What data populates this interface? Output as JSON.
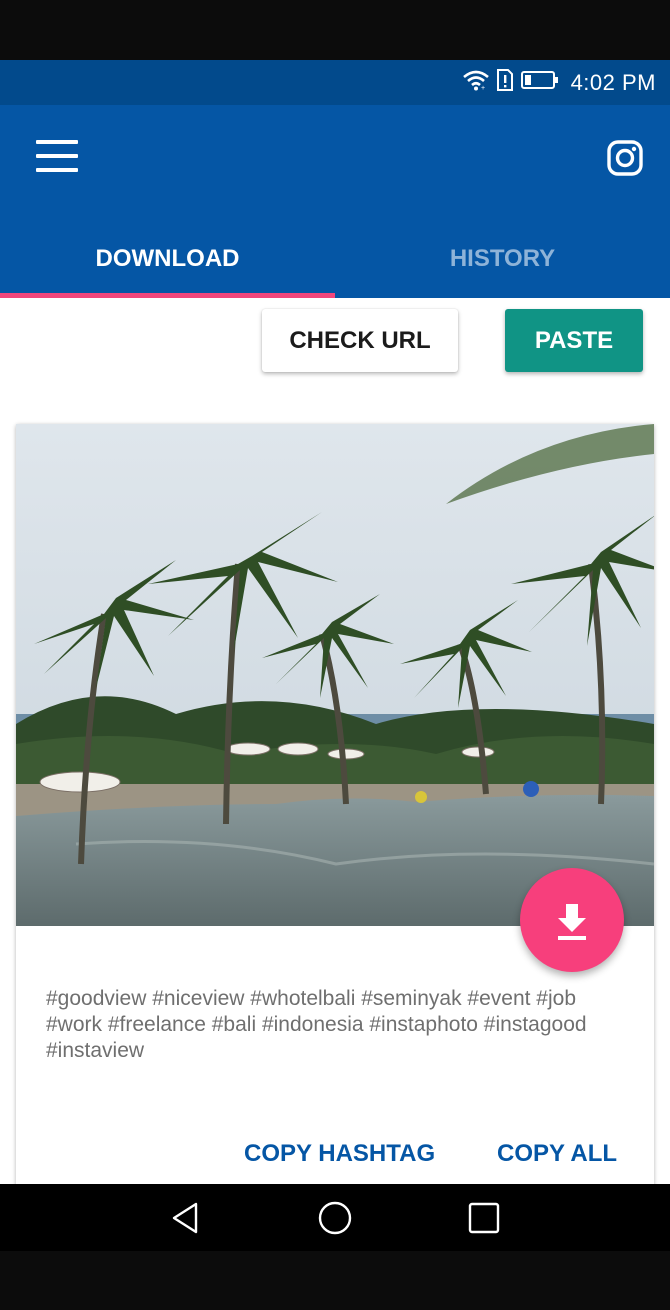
{
  "status_bar": {
    "time": "4:02 PM",
    "icons": [
      "wifi-icon",
      "sim-alert-icon",
      "battery-icon"
    ]
  },
  "app_bar": {
    "menu_icon": "hamburger-menu-icon",
    "action_icon": "instagram-icon"
  },
  "tabs": [
    {
      "label": "DOWNLOAD",
      "active": true
    },
    {
      "label": "HISTORY",
      "active": false
    }
  ],
  "actions": {
    "check_url_label": "CHECK URL",
    "paste_label": "PASTE"
  },
  "post": {
    "image": "resort-infinity-pool-with-palm-trees",
    "download_icon": "download-icon",
    "caption": "#goodview #niceview #whotelbali #seminyak #event #job #work #freelance #bali #indonesia #instaphoto #instagood #instaview",
    "copy_hashtag_label": "COPY HASHTAG",
    "copy_all_label": "COPY ALL"
  },
  "nav_bar": {
    "icons": [
      "back-icon",
      "home-icon",
      "recents-icon"
    ]
  },
  "colors": {
    "status_bar": "#024a8c",
    "primary": "#0556a5",
    "tab_indicator": "#f2467c",
    "paste_button": "#109485",
    "fab": "#f73f7c",
    "caption_text": "#6f6f6f"
  }
}
